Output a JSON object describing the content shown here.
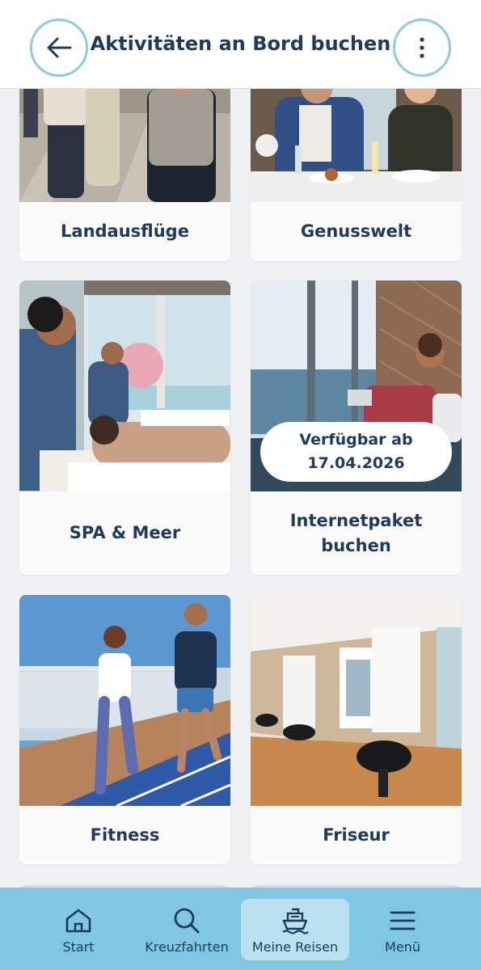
{
  "header": {
    "title": "Aktivitäten an Bord buchen",
    "back_icon": "arrow-left-icon",
    "more_icon": "more-vertical-icon"
  },
  "cards": [
    {
      "label": "Landausflüge"
    },
    {
      "label": "Genusswelt"
    },
    {
      "label": "SPA & Meer"
    },
    {
      "label": "Internetpaket buchen",
      "badge_line1": "Verfügbar ab",
      "badge_line2": "17.04.2026"
    },
    {
      "label": "Fitness"
    },
    {
      "label": "Friseur"
    }
  ],
  "nav": {
    "items": [
      {
        "label": "Start",
        "icon": "home-icon"
      },
      {
        "label": "Kreuzfahrten",
        "icon": "search-icon"
      },
      {
        "label": "Meine Reisen",
        "icon": "ship-icon",
        "active": true
      },
      {
        "label": "Menü",
        "icon": "menu-icon"
      }
    ]
  },
  "colors": {
    "primary_text": "#1f3b5c",
    "accent_border": "#8fcbe0",
    "nav_bg": "#7fc7e2",
    "nav_active": "#b9e1ef"
  }
}
